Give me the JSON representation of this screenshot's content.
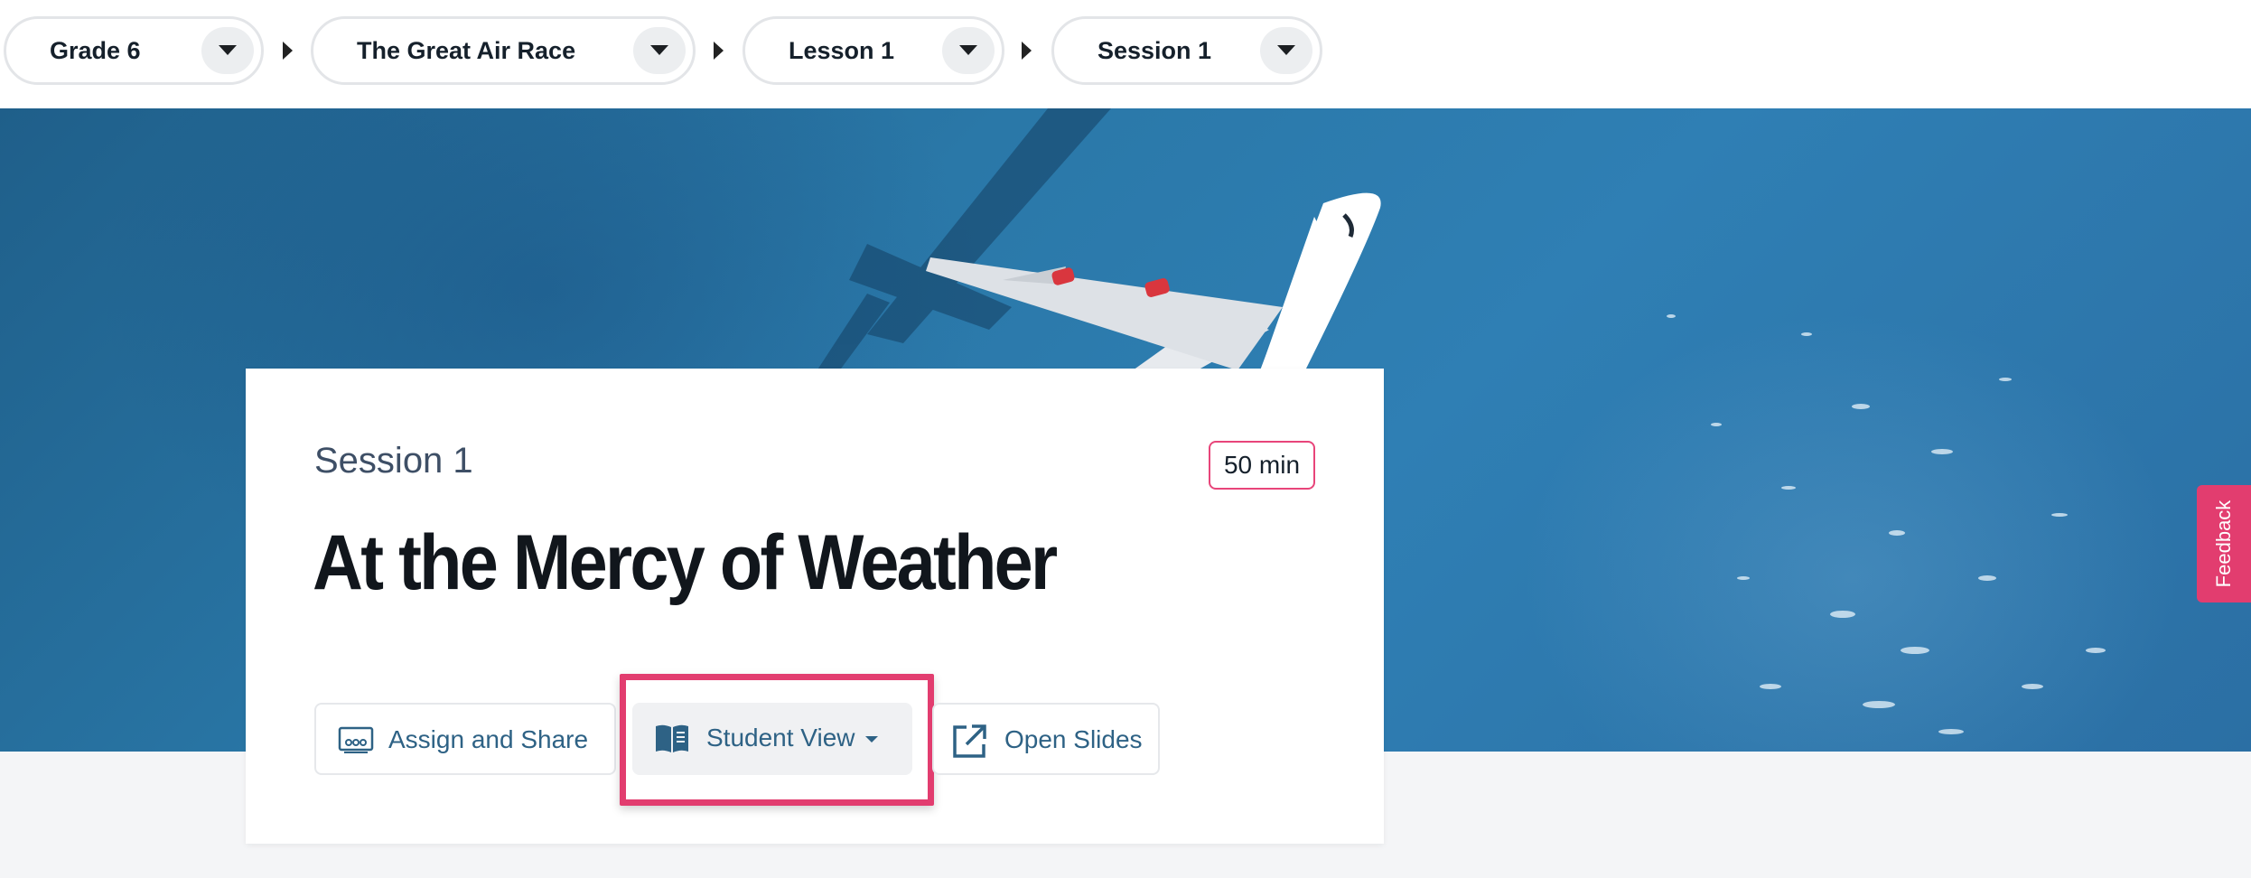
{
  "breadcrumb": {
    "items": [
      {
        "label": "Grade 6"
      },
      {
        "label": "The Great Air Race"
      },
      {
        "label": "Lesson 1"
      },
      {
        "label": "Session 1"
      }
    ]
  },
  "hero": {
    "image": "airplane-over-ocean"
  },
  "session_card": {
    "session_label": "Session 1",
    "duration": "50 min",
    "title": "At the Mercy of Weather",
    "actions": {
      "assign_share": {
        "label": "Assign and Share",
        "icon": "assign-share-icon"
      },
      "student_view": {
        "label": "Student View",
        "icon": "book-icon",
        "highlighted": true
      },
      "open_slides": {
        "label": "Open Slides",
        "icon": "external-link-icon"
      }
    }
  },
  "feedback": {
    "label": "Feedback"
  },
  "colors": {
    "accent_pink": "#e23d6f",
    "link_blue": "#2e6285",
    "title_dark": "#11161c",
    "ocean_blue": "#2a78a8"
  }
}
